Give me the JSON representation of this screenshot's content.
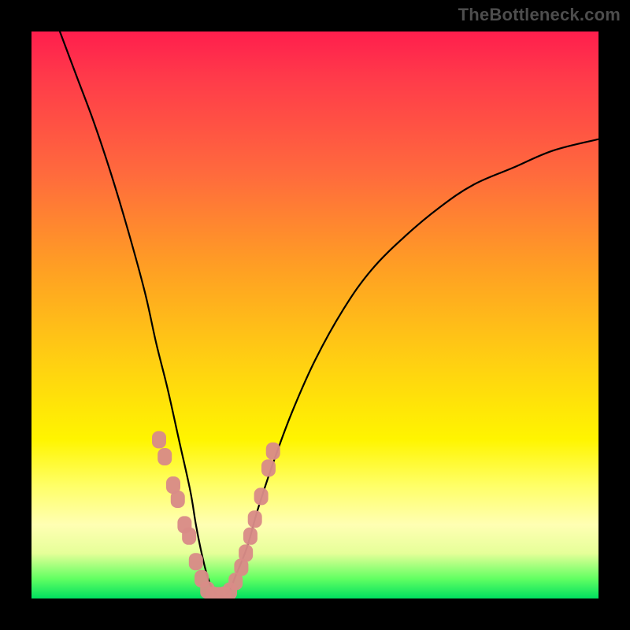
{
  "watermark": "TheBottleneck.com",
  "colors": {
    "frame": "#000000",
    "curve": "#000000",
    "marker_fill": "#d88b87",
    "gradient_stops": [
      "#ff1e4d",
      "#ff6a3d",
      "#ffa023",
      "#ffcf12",
      "#fff500",
      "#ffff66",
      "#ffffb3",
      "#62ff62",
      "#00e060"
    ]
  },
  "chart_data": {
    "type": "line",
    "title": "",
    "xlabel": "",
    "ylabel": "",
    "xlim": [
      0,
      100
    ],
    "ylim": [
      0,
      100
    ],
    "grid": false,
    "legend": false,
    "series": [
      {
        "name": "bottleneck-curve",
        "x": [
          5,
          8,
          11,
          14,
          17,
          20,
          22,
          24,
          26,
          28,
          29,
          30,
          31,
          32,
          33,
          34,
          35,
          36,
          38,
          40,
          43,
          46,
          50,
          55,
          60,
          66,
          72,
          78,
          85,
          92,
          100
        ],
        "y": [
          100,
          92,
          84,
          75,
          65,
          54,
          45,
          37,
          28,
          19,
          13,
          8,
          4,
          1.5,
          0.5,
          0.5,
          1.5,
          4,
          9,
          16,
          25,
          33,
          42,
          51,
          58,
          64,
          69,
          73,
          76,
          79,
          81
        ]
      }
    ],
    "markers": {
      "name": "highlight-points",
      "x_range_description": "cluster of points along the valley of the curve, roughly x≈22–40, y≈0–25",
      "points": [
        {
          "x": 22.5,
          "y": 28
        },
        {
          "x": 23.5,
          "y": 25
        },
        {
          "x": 25.0,
          "y": 20
        },
        {
          "x": 25.8,
          "y": 17.5
        },
        {
          "x": 27.0,
          "y": 13
        },
        {
          "x": 27.8,
          "y": 11
        },
        {
          "x": 29.0,
          "y": 6.5
        },
        {
          "x": 30.0,
          "y": 3.5
        },
        {
          "x": 31.0,
          "y": 1.5
        },
        {
          "x": 32.0,
          "y": 0.6
        },
        {
          "x": 33.0,
          "y": 0.5
        },
        {
          "x": 34.0,
          "y": 0.6
        },
        {
          "x": 35.0,
          "y": 1.3
        },
        {
          "x": 36.0,
          "y": 3.0
        },
        {
          "x": 37.0,
          "y": 5.5
        },
        {
          "x": 37.8,
          "y": 8.0
        },
        {
          "x": 38.6,
          "y": 11.0
        },
        {
          "x": 39.4,
          "y": 14.0
        },
        {
          "x": 40.5,
          "y": 18.0
        },
        {
          "x": 41.8,
          "y": 23.0
        },
        {
          "x": 42.6,
          "y": 26.0
        }
      ]
    }
  }
}
